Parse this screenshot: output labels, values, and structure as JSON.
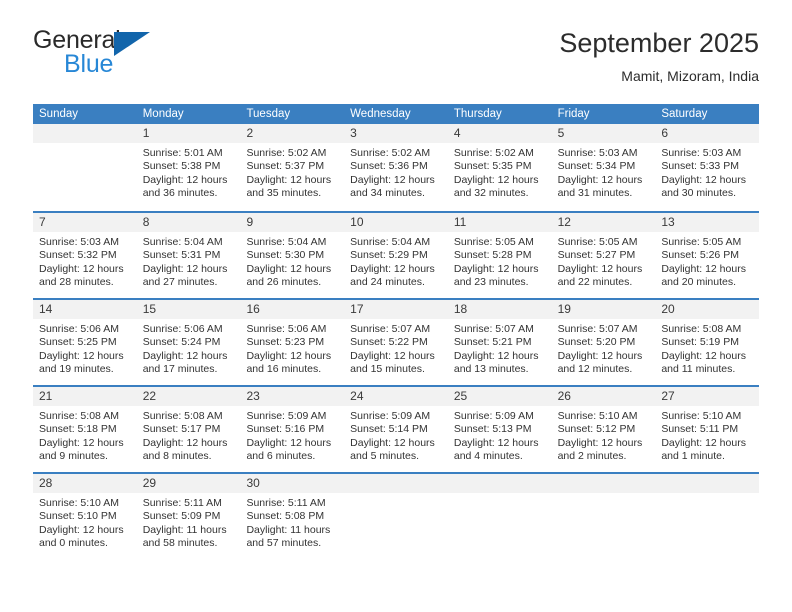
{
  "brand": {
    "line1": "General",
    "line2": "Blue",
    "logo_icon": "triangle-logo-icon",
    "accent_color": "#1265ab",
    "blue_text_color": "#2787d6"
  },
  "header": {
    "title": "September 2025",
    "subtitle": "Mamit, Mizoram, India"
  },
  "calendar": {
    "header_bg_color": "#3a7fc1",
    "day_number_bg_color": "#f2f2f2",
    "weekdays": [
      "Sunday",
      "Monday",
      "Tuesday",
      "Wednesday",
      "Thursday",
      "Friday",
      "Saturday"
    ],
    "weeks": [
      [
        {
          "day": "",
          "lines": []
        },
        {
          "day": "1",
          "lines": [
            "Sunrise: 5:01 AM",
            "Sunset: 5:38 PM",
            "Daylight: 12 hours",
            "and 36 minutes."
          ]
        },
        {
          "day": "2",
          "lines": [
            "Sunrise: 5:02 AM",
            "Sunset: 5:37 PM",
            "Daylight: 12 hours",
            "and 35 minutes."
          ]
        },
        {
          "day": "3",
          "lines": [
            "Sunrise: 5:02 AM",
            "Sunset: 5:36 PM",
            "Daylight: 12 hours",
            "and 34 minutes."
          ]
        },
        {
          "day": "4",
          "lines": [
            "Sunrise: 5:02 AM",
            "Sunset: 5:35 PM",
            "Daylight: 12 hours",
            "and 32 minutes."
          ]
        },
        {
          "day": "5",
          "lines": [
            "Sunrise: 5:03 AM",
            "Sunset: 5:34 PM",
            "Daylight: 12 hours",
            "and 31 minutes."
          ]
        },
        {
          "day": "6",
          "lines": [
            "Sunrise: 5:03 AM",
            "Sunset: 5:33 PM",
            "Daylight: 12 hours",
            "and 30 minutes."
          ]
        }
      ],
      [
        {
          "day": "7",
          "lines": [
            "Sunrise: 5:03 AM",
            "Sunset: 5:32 PM",
            "Daylight: 12 hours",
            "and 28 minutes."
          ]
        },
        {
          "day": "8",
          "lines": [
            "Sunrise: 5:04 AM",
            "Sunset: 5:31 PM",
            "Daylight: 12 hours",
            "and 27 minutes."
          ]
        },
        {
          "day": "9",
          "lines": [
            "Sunrise: 5:04 AM",
            "Sunset: 5:30 PM",
            "Daylight: 12 hours",
            "and 26 minutes."
          ]
        },
        {
          "day": "10",
          "lines": [
            "Sunrise: 5:04 AM",
            "Sunset: 5:29 PM",
            "Daylight: 12 hours",
            "and 24 minutes."
          ]
        },
        {
          "day": "11",
          "lines": [
            "Sunrise: 5:05 AM",
            "Sunset: 5:28 PM",
            "Daylight: 12 hours",
            "and 23 minutes."
          ]
        },
        {
          "day": "12",
          "lines": [
            "Sunrise: 5:05 AM",
            "Sunset: 5:27 PM",
            "Daylight: 12 hours",
            "and 22 minutes."
          ]
        },
        {
          "day": "13",
          "lines": [
            "Sunrise: 5:05 AM",
            "Sunset: 5:26 PM",
            "Daylight: 12 hours",
            "and 20 minutes."
          ]
        }
      ],
      [
        {
          "day": "14",
          "lines": [
            "Sunrise: 5:06 AM",
            "Sunset: 5:25 PM",
            "Daylight: 12 hours",
            "and 19 minutes."
          ]
        },
        {
          "day": "15",
          "lines": [
            "Sunrise: 5:06 AM",
            "Sunset: 5:24 PM",
            "Daylight: 12 hours",
            "and 17 minutes."
          ]
        },
        {
          "day": "16",
          "lines": [
            "Sunrise: 5:06 AM",
            "Sunset: 5:23 PM",
            "Daylight: 12 hours",
            "and 16 minutes."
          ]
        },
        {
          "day": "17",
          "lines": [
            "Sunrise: 5:07 AM",
            "Sunset: 5:22 PM",
            "Daylight: 12 hours",
            "and 15 minutes."
          ]
        },
        {
          "day": "18",
          "lines": [
            "Sunrise: 5:07 AM",
            "Sunset: 5:21 PM",
            "Daylight: 12 hours",
            "and 13 minutes."
          ]
        },
        {
          "day": "19",
          "lines": [
            "Sunrise: 5:07 AM",
            "Sunset: 5:20 PM",
            "Daylight: 12 hours",
            "and 12 minutes."
          ]
        },
        {
          "day": "20",
          "lines": [
            "Sunrise: 5:08 AM",
            "Sunset: 5:19 PM",
            "Daylight: 12 hours",
            "and 11 minutes."
          ]
        }
      ],
      [
        {
          "day": "21",
          "lines": [
            "Sunrise: 5:08 AM",
            "Sunset: 5:18 PM",
            "Daylight: 12 hours",
            "and 9 minutes."
          ]
        },
        {
          "day": "22",
          "lines": [
            "Sunrise: 5:08 AM",
            "Sunset: 5:17 PM",
            "Daylight: 12 hours",
            "and 8 minutes."
          ]
        },
        {
          "day": "23",
          "lines": [
            "Sunrise: 5:09 AM",
            "Sunset: 5:16 PM",
            "Daylight: 12 hours",
            "and 6 minutes."
          ]
        },
        {
          "day": "24",
          "lines": [
            "Sunrise: 5:09 AM",
            "Sunset: 5:14 PM",
            "Daylight: 12 hours",
            "and 5 minutes."
          ]
        },
        {
          "day": "25",
          "lines": [
            "Sunrise: 5:09 AM",
            "Sunset: 5:13 PM",
            "Daylight: 12 hours",
            "and 4 minutes."
          ]
        },
        {
          "day": "26",
          "lines": [
            "Sunrise: 5:10 AM",
            "Sunset: 5:12 PM",
            "Daylight: 12 hours",
            "and 2 minutes."
          ]
        },
        {
          "day": "27",
          "lines": [
            "Sunrise: 5:10 AM",
            "Sunset: 5:11 PM",
            "Daylight: 12 hours",
            "and 1 minute."
          ]
        }
      ],
      [
        {
          "day": "28",
          "lines": [
            "Sunrise: 5:10 AM",
            "Sunset: 5:10 PM",
            "Daylight: 12 hours",
            "and 0 minutes."
          ]
        },
        {
          "day": "29",
          "lines": [
            "Sunrise: 5:11 AM",
            "Sunset: 5:09 PM",
            "Daylight: 11 hours",
            "and 58 minutes."
          ]
        },
        {
          "day": "30",
          "lines": [
            "Sunrise: 5:11 AM",
            "Sunset: 5:08 PM",
            "Daylight: 11 hours",
            "and 57 minutes."
          ]
        },
        {
          "day": "",
          "lines": []
        },
        {
          "day": "",
          "lines": []
        },
        {
          "day": "",
          "lines": []
        },
        {
          "day": "",
          "lines": []
        }
      ]
    ]
  }
}
